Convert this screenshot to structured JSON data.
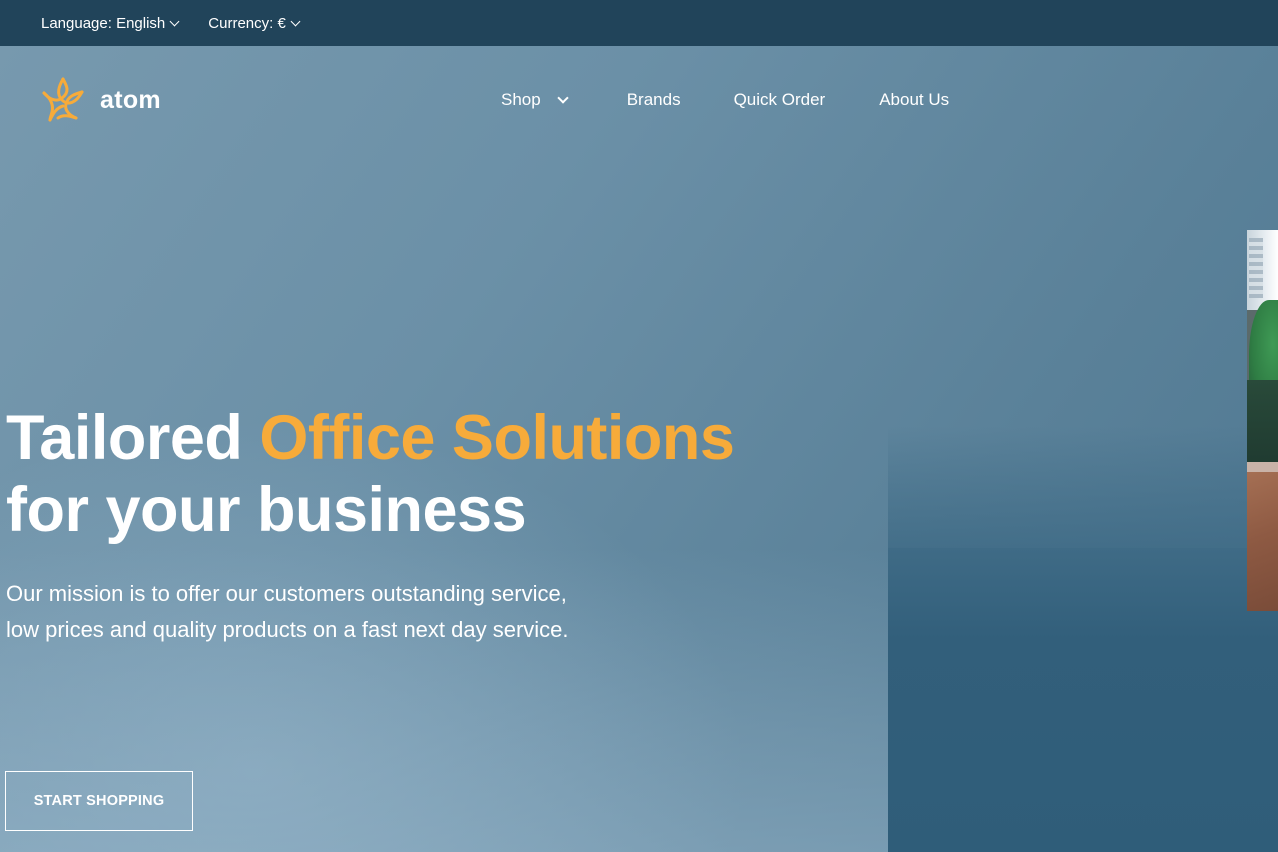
{
  "topbar": {
    "language_label": "Language: English",
    "currency_label": "Currency: €"
  },
  "header": {
    "logo_text": "atom",
    "logo_icon": "atom-star-icon",
    "nav": [
      {
        "label": "Shop",
        "has_dropdown": true
      },
      {
        "label": "Brands",
        "has_dropdown": false
      },
      {
        "label": "Quick Order",
        "has_dropdown": false
      },
      {
        "label": "About Us",
        "has_dropdown": false
      }
    ]
  },
  "hero": {
    "title_part1": "Tailored ",
    "title_accent": "Office Solutions",
    "title_part2": "for your business",
    "description": "Our mission is to offer our customers outstanding service, low prices and quality products on a fast next day service.",
    "cta_label": "START SHOPPING"
  },
  "colors": {
    "topbar_bg": "#21445a",
    "accent": "#f7ab3a",
    "hero_bg": "#6b90a7",
    "text": "#ffffff"
  }
}
